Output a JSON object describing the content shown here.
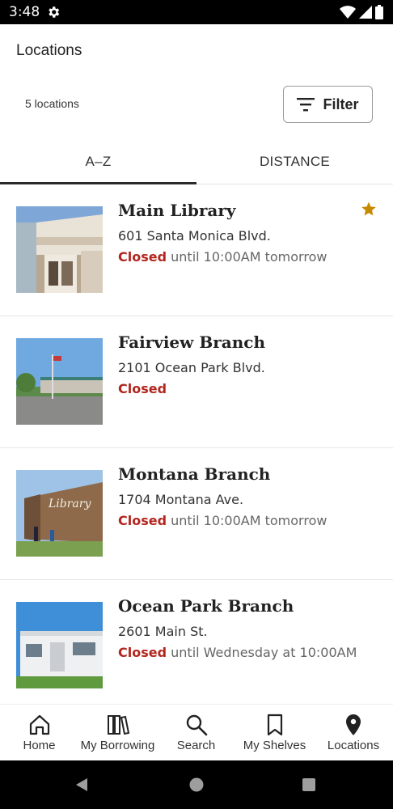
{
  "status_bar": {
    "time": "3:48"
  },
  "header": {
    "title": "Locations"
  },
  "toolbar": {
    "count_text": "5 locations",
    "filter_label": "Filter"
  },
  "tabs": [
    {
      "label": "A–Z",
      "selected": true
    },
    {
      "label": "DISTANCE",
      "selected": false
    }
  ],
  "locations": [
    {
      "name": "Main Library",
      "address": "601 Santa Monica Blvd.",
      "status": "Closed",
      "status_detail": "until 10:00AM tomorrow",
      "favorite": true
    },
    {
      "name": "Fairview Branch",
      "address": "2101 Ocean Park Blvd.",
      "status": "Closed",
      "status_detail": "",
      "favorite": false
    },
    {
      "name": "Montana Branch",
      "address": "1704 Montana Ave.",
      "status": "Closed",
      "status_detail": "until 10:00AM tomorrow",
      "favorite": false
    },
    {
      "name": "Ocean Park Branch",
      "address": "2601 Main St.",
      "status": "Closed",
      "status_detail": "until Wednesday at 10:00AM",
      "favorite": false
    }
  ],
  "bottom_nav": [
    {
      "label": "Home",
      "icon": "home-icon"
    },
    {
      "label": "My Borrowing",
      "icon": "books-icon"
    },
    {
      "label": "Search",
      "icon": "search-icon"
    },
    {
      "label": "My Shelves",
      "icon": "bookmark-icon"
    },
    {
      "label": "Locations",
      "icon": "location-pin-icon"
    }
  ],
  "colors": {
    "closed": "#b3261e",
    "star": "#c68a00",
    "tab_indicator": "#2a2a2a"
  }
}
